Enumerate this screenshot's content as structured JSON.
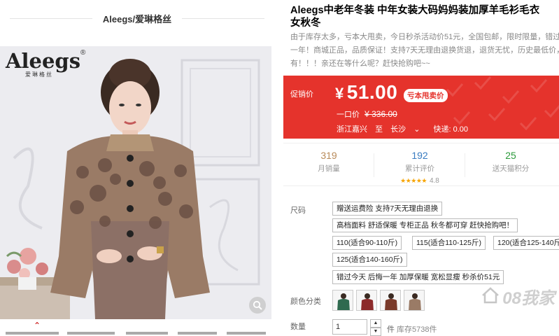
{
  "shop": {
    "name": "Aleegs/爱琳格丝"
  },
  "brand_logo": {
    "main": "Aleegs",
    "reg": "®",
    "sub": "爱琳格丝"
  },
  "product": {
    "title_line1": "Aleegs中老年冬装 中年女装大码妈妈装加厚羊毛衫毛衣",
    "title_line2": "女秋冬",
    "desc_lines": [
      "由于库存太多，亏本大甩卖，今日秒杀活动价51元，全国包邮，限时限量，错过今天",
      "一年！商城正品，品质保证！支持7天无理由退换货退，退货无忧，历史最低价，绝",
      "有！！！亲还在等什么呢？赶快抢购吧~~"
    ]
  },
  "price_box": {
    "promo_label": "促销价",
    "currency": "¥",
    "price": "51.00",
    "tag": "亏本甩卖价",
    "orig_label": "一口价",
    "orig_currency": "¥",
    "orig_price": "336.00",
    "ship_from": "浙江嘉兴",
    "ship_to_word": "至",
    "ship_to": "长沙",
    "ship_arrow": "⌄",
    "express": "快递: 0.00"
  },
  "stats": [
    {
      "num": "319",
      "label": "月销量",
      "color": "#b98b5a"
    },
    {
      "num": "192",
      "label": "累计评价",
      "color": "#3a7cc1",
      "stars": "★★★★★",
      "score": "4.8"
    },
    {
      "num": "25",
      "label": "送天猫积分",
      "color": "#2b9a3a"
    }
  ],
  "size": {
    "label": "尺码",
    "options": [
      "赠送运费险 支持7天无理由退换",
      "高档面料 舒适保暖 专柜正品 秋冬都可穿 赶快抢购吧！",
      "110(适合90-110斤)",
      "115(适合110-125斤)",
      "120(适合125-140斤",
      "125(适合140-160斤)",
      "错过今天 后悔一年 加厚保暖 宽松显瘦 秒杀价51元"
    ]
  },
  "color": {
    "label": "颜色分类",
    "swatches": [
      "green-variant",
      "red-variant",
      "brown-red-variant",
      "tan-variant"
    ]
  },
  "quantity": {
    "label": "数量",
    "value": "1",
    "unit": "件",
    "stock": "库存5738件",
    "up": "▲",
    "down": "▼"
  },
  "watermark": "08我家"
}
